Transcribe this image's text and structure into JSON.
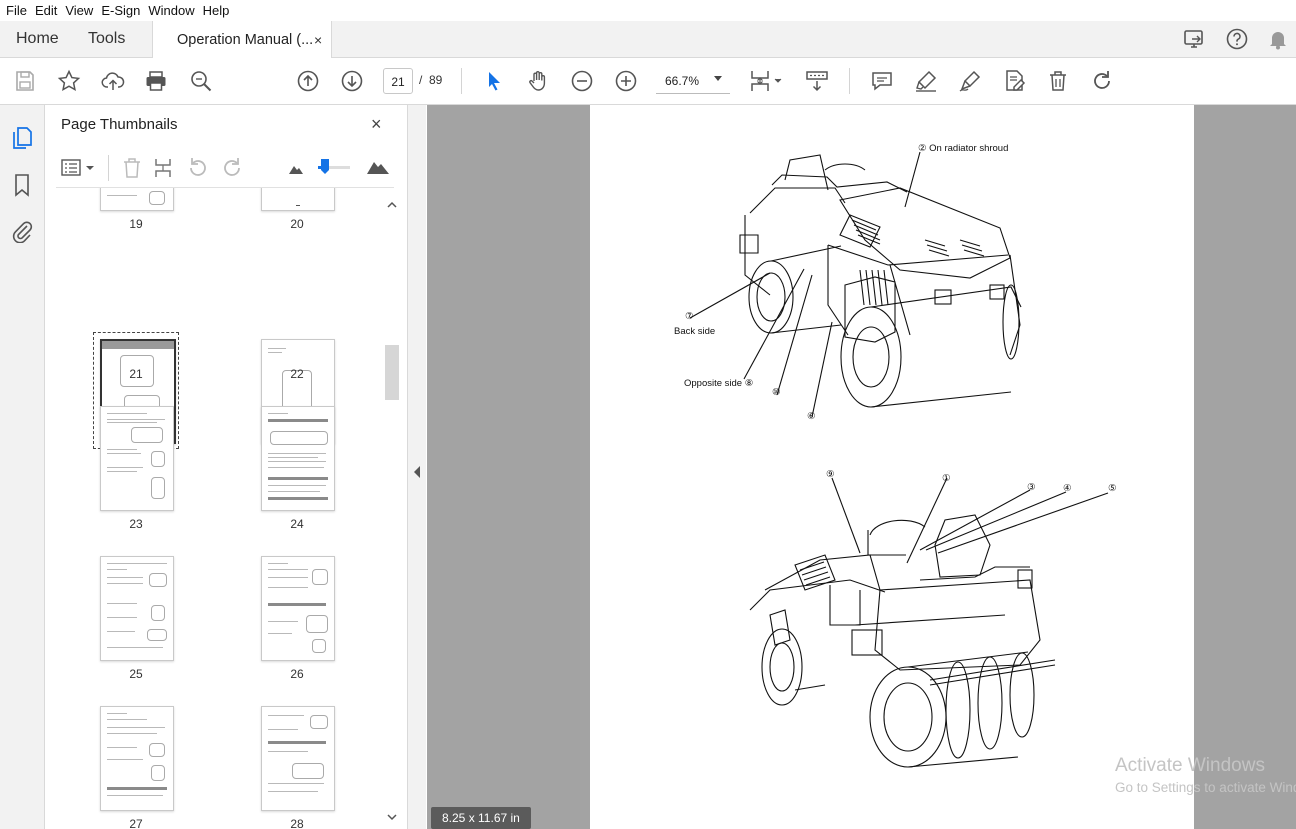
{
  "menu": {
    "items": [
      "File",
      "Edit",
      "View",
      "E-Sign",
      "Window",
      "Help"
    ]
  },
  "tabs": {
    "home": "Home",
    "tools": "Tools",
    "document": "Operation Manual (...",
    "close_glyph": "×"
  },
  "toolbar": {
    "current_page": "21",
    "page_separator": "/",
    "total_pages": "89",
    "zoom": "66.7%"
  },
  "thumbnails": {
    "title": "Page Thumbnails",
    "close_glyph": "×",
    "selected_page": "21",
    "pages": [
      "19",
      "20",
      "21",
      "22",
      "23",
      "24",
      "25",
      "26",
      "27",
      "28"
    ]
  },
  "viewer": {
    "page_size": "8.25 x 11.67 in",
    "labels": {
      "radiator": "② On radiator shroud",
      "back_num": "⑦",
      "back_side": "Back side",
      "opposite_side": "Opposite side ⑧",
      "n10": "⑩",
      "n6": "⑥",
      "n9": "⑨",
      "n1": "①",
      "n3": "③",
      "n4": "④",
      "n5": "⑤"
    }
  },
  "watermark": {
    "line1": "Activate Windows",
    "line2": "Go to Settings to activate Windows."
  },
  "colors": {
    "accent": "#1473e6",
    "chrome": "#f2f2f2",
    "viewer_bg": "#a3a3a3"
  }
}
